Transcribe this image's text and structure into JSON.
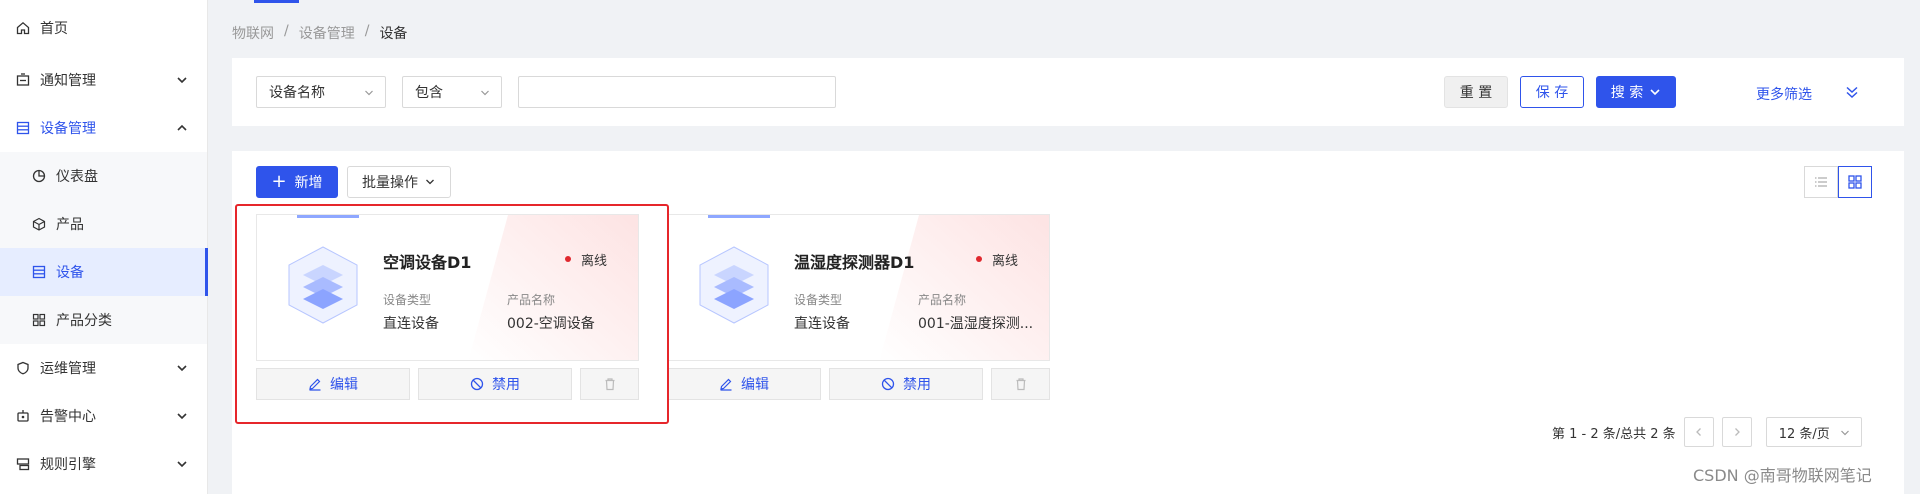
{
  "colors": {
    "accent": "#2f54eb",
    "offline": "#e0282e",
    "highlight": "#e6262b"
  },
  "sidebar": {
    "items": [
      {
        "label": "首页",
        "icon": "home-icon"
      },
      {
        "label": "通知管理",
        "icon": "notice-icon"
      },
      {
        "label": "设备管理",
        "icon": "device-manage-icon",
        "expanded": true
      },
      {
        "label": "仪表盘",
        "icon": "dashboard-icon"
      },
      {
        "label": "产品",
        "icon": "cube-icon"
      },
      {
        "label": "设备",
        "icon": "device-icon",
        "selected": true
      },
      {
        "label": "产品分类",
        "icon": "category-icon"
      },
      {
        "label": "运维管理",
        "icon": "ops-icon"
      },
      {
        "label": "告警中心",
        "icon": "alarm-icon"
      },
      {
        "label": "规则引擎",
        "icon": "rule-icon"
      }
    ]
  },
  "breadcrumb": {
    "items": [
      "物联网",
      "设备管理",
      "设备"
    ],
    "separator": "/"
  },
  "filter": {
    "field_select": "设备名称",
    "operator_select": "包含",
    "value": "",
    "reset_label": "重 置",
    "save_label": "保 存",
    "search_label": "搜 索",
    "more_label": "更多筛选"
  },
  "toolbar": {
    "add_label": "新增",
    "batch_label": "批量操作"
  },
  "cards": [
    {
      "name": "空调设备D1",
      "status": "离线",
      "type_label": "设备类型",
      "type_value": "直连设备",
      "product_label": "产品名称",
      "product_value": "002-空调设备",
      "edit_label": "编辑",
      "disable_label": "禁用"
    },
    {
      "name": "温湿度探测器D1",
      "status": "离线",
      "type_label": "设备类型",
      "type_value": "直连设备",
      "product_label": "产品名称",
      "product_value": "001-温湿度探测...",
      "edit_label": "编辑",
      "disable_label": "禁用"
    }
  ],
  "pagination": {
    "summary": "第 1 - 2 条/总共 2 条",
    "page_size": "12 条/页"
  },
  "watermark": "CSDN @南哥物联网笔记"
}
